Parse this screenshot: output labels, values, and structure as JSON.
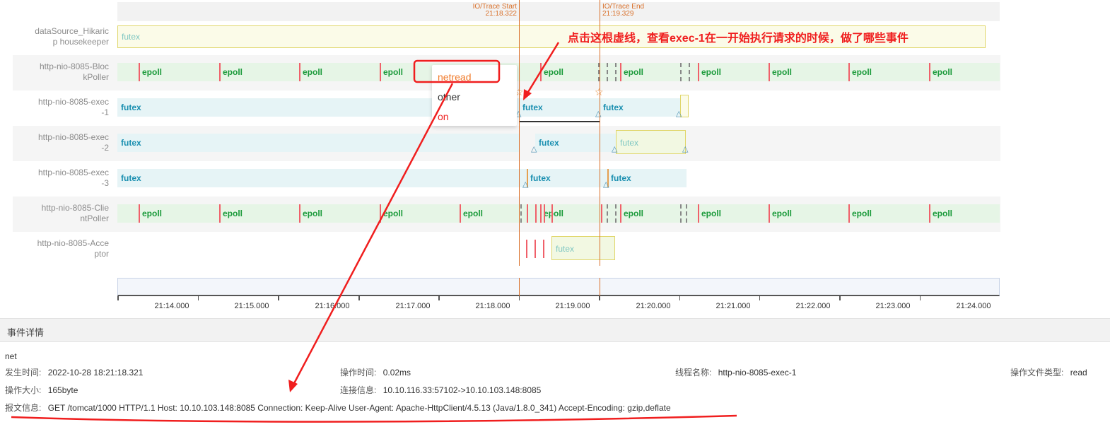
{
  "markers": {
    "start_label": "IO/Trace Start",
    "start_time": "21:18.322",
    "end_label": "IO/Trace End",
    "end_time": "21:19.329"
  },
  "lanes": [
    {
      "label": "dataSource_Hikaric\np housekeeper",
      "segment": "futex"
    },
    {
      "label": "http-nio-8085-Bloc\nkPoller",
      "segment": "epoll"
    },
    {
      "label": "http-nio-8085-exec\n-1",
      "segment": "futex"
    },
    {
      "label": "http-nio-8085-exec\n-2",
      "segment": "futex"
    },
    {
      "label": "http-nio-8085-exec\n-3",
      "segment": "futex"
    },
    {
      "label": "http-nio-8085-Clie\nntPoller",
      "segment": "epoll"
    },
    {
      "label": "http-nio-8085-Acce\nptor",
      "segment": "futex"
    }
  ],
  "axis_ticks": [
    "21:14.000",
    "21:15.000",
    "21:16.000",
    "21:17.000",
    "21:18.000",
    "21:19.000",
    "21:20.000",
    "21:21.000",
    "21:22.000",
    "21:23.000",
    "21:24.000"
  ],
  "popup": {
    "items": [
      "netread",
      "other",
      "on"
    ]
  },
  "annotation": "点击这根虚线，查看exec-1在一开始执行请求的时候，做了哪些事件",
  "details": {
    "title": "事件详情",
    "type": "net",
    "occur_time_key": "发生时间:",
    "occur_time": "2022-10-28 18:21:18.321",
    "op_time_key": "操作时间:",
    "op_time": "0.02ms",
    "thread_key": "线程名称:",
    "thread": "http-nio-8085-exec-1",
    "file_type_key": "操作文件类型:",
    "file_type": "read",
    "op_size_key": "操作大小:",
    "op_size": "165byte",
    "conn_key": "连接信息:",
    "conn": "10.10.116.33:57102->10.10.103.148:8085",
    "message_key": "报文信息:",
    "message": "GET /tomcat/1000 HTTP/1.1 Host: 10.10.103.148:8085 Connection: Keep-Alive User-Agent: Apache-HttpClient/4.5.13 (Java/1.8.0_341) Accept-Encoding: gzip,deflate"
  },
  "colors": {
    "futex": "#1a8fb0",
    "epoll": "#1a9a3a",
    "marker": "#d9702a",
    "annotation": "#f01e1e"
  }
}
